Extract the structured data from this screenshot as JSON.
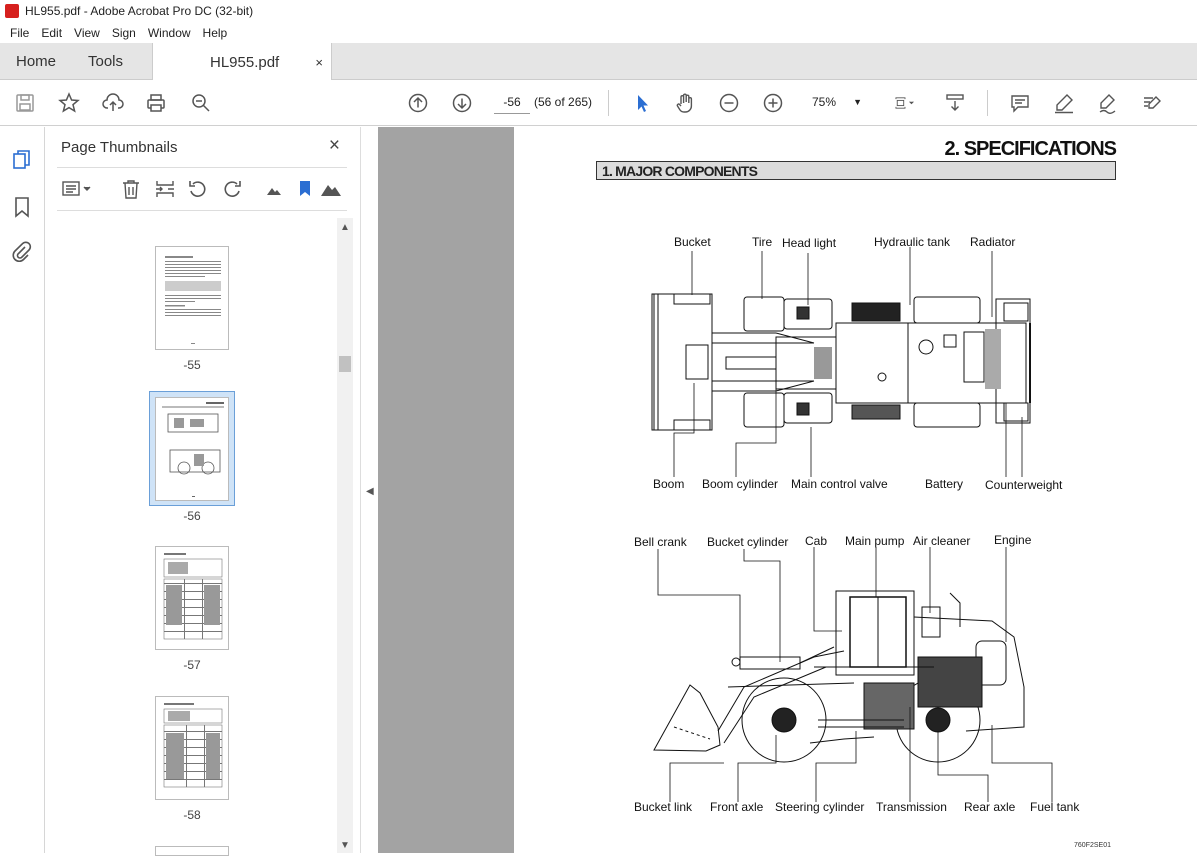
{
  "window": {
    "title": "HL955.pdf - Adobe Acrobat Pro DC (32-bit)"
  },
  "menu": [
    "File",
    "Edit",
    "View",
    "Sign",
    "Window",
    "Help"
  ],
  "tabs": {
    "home": "Home",
    "tools": "Tools",
    "doc": "HL955.pdf",
    "close": "×"
  },
  "nav": {
    "page_value": "-56",
    "page_count": "(56 of 265)",
    "zoom": "75%"
  },
  "panel": {
    "title": "Page Thumbnails",
    "close": "×",
    "thumbnails": [
      {
        "label": "-55",
        "selected": false
      },
      {
        "label": "-56",
        "selected": true
      },
      {
        "label": "-57",
        "selected": false
      },
      {
        "label": "-58",
        "selected": false
      }
    ]
  },
  "doc": {
    "section_title": "2. SPECIFICATIONS",
    "subsection": "1. MAJOR COMPONENTS",
    "top_view_labels": {
      "bucket": "Bucket",
      "tire": "Tire",
      "head_light": "Head light",
      "hydraulic_tank": "Hydraulic tank",
      "radiator": "Radiator",
      "boom": "Boom",
      "boom_cylinder": "Boom cylinder",
      "main_control_valve": "Main control valve",
      "battery": "Battery",
      "counterweight": "Counterweight"
    },
    "side_view_labels": {
      "bell_crank": "Bell crank",
      "bucket_cylinder": "Bucket cylinder",
      "cab": "Cab",
      "main_pump": "Main pump",
      "air_cleaner": "Air cleaner",
      "engine": "Engine",
      "bucket_link": "Bucket link",
      "front_axle": "Front axle",
      "steering_cylinder": "Steering cylinder",
      "transmission": "Transmission",
      "rear_axle": "Rear axle",
      "fuel_tank": "Fuel tank"
    },
    "figure_code": "760F2SE01"
  }
}
